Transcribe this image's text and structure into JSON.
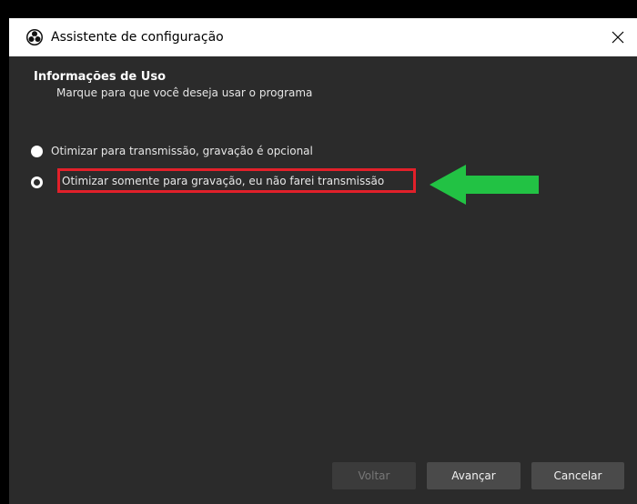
{
  "window": {
    "title": "Assistente de configuração",
    "icon": "obs-logo-icon",
    "close_symbol": "✕"
  },
  "page": {
    "heading": "Informações de Uso",
    "subheading": "Marque para que você deseja usar o programa"
  },
  "options": [
    {
      "label": "Otimizar para transmissão, gravação é opcional",
      "selected": false
    },
    {
      "label": "Otimizar somente para gravação, eu não farei transmissão",
      "selected": true
    }
  ],
  "annotation": {
    "highlight_color": "#e2202a",
    "arrow_color": "#22c244",
    "arrow_direction": "left"
  },
  "footer": {
    "back_label": "Voltar",
    "back_enabled": false,
    "next_label": "Avançar",
    "cancel_label": "Cancelar"
  },
  "colors": {
    "background": "#2b2b2b",
    "titlebar": "#ffffff",
    "button": "#4a4a4a"
  }
}
